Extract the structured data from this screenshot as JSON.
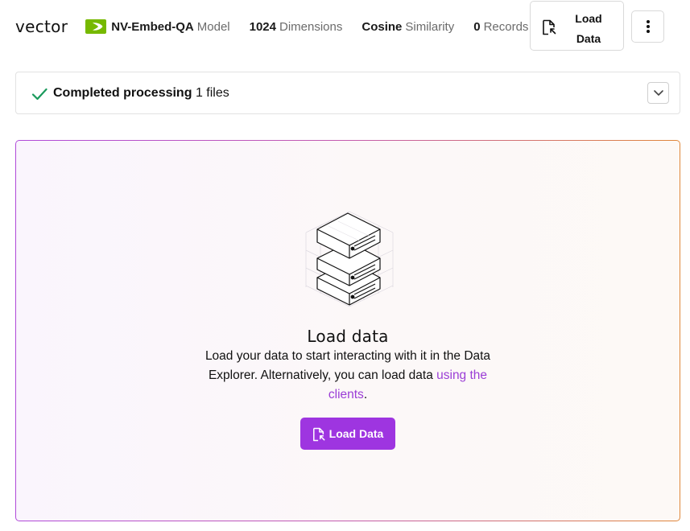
{
  "header": {
    "index_name": "vector",
    "model": {
      "name": "NV-Embed-QA",
      "suffix": "Model"
    },
    "dimensions": {
      "value": "1024",
      "suffix": "Dimensions"
    },
    "metric": {
      "value": "Cosine",
      "suffix": "Similarity"
    },
    "records": {
      "value": "0",
      "suffix": "Records"
    },
    "load_button": {
      "line1": "Load",
      "line2": "Data"
    }
  },
  "status": {
    "strong": "Completed processing",
    "rest": "1 files",
    "check_color": "#1a9a5c"
  },
  "empty_state": {
    "title": "Load data",
    "desc_before": "Load your data to start interacting with it in the Data Explorer. Alternatively, you can load data ",
    "desc_link": "using the clients",
    "desc_after": ".",
    "button_label": "Load Data",
    "accent_color": "#9e35e0"
  },
  "icons": {
    "nvidia_logo": "nvidia-logo",
    "file_upload": "file-upload-icon",
    "more": "more-vertical-icon",
    "check": "check-icon",
    "chevron": "chevron-down-icon",
    "illustration": "server-stack-illustration"
  }
}
